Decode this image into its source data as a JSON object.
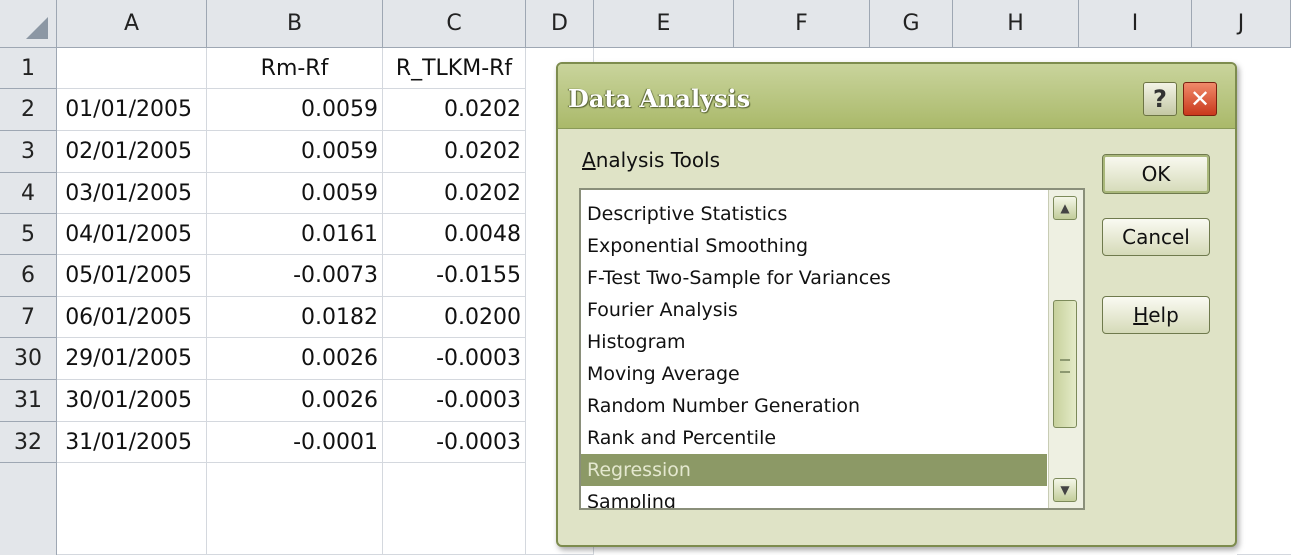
{
  "spreadsheet": {
    "column_headers": [
      "A",
      "B",
      "C",
      "D",
      "E",
      "F",
      "G",
      "H",
      "I",
      "J"
    ],
    "row_headers": [
      "1",
      "2",
      "3",
      "4",
      "5",
      "6",
      "7",
      "30",
      "31",
      "32"
    ],
    "header_row": {
      "A": "",
      "B": "Rm-Rf",
      "C": "R_TLKM-Rf"
    },
    "rows": [
      {
        "date": "01/01/2005",
        "rm_rf": "0.0059",
        "r_tlkm_rf": "0.0202"
      },
      {
        "date": "02/01/2005",
        "rm_rf": "0.0059",
        "r_tlkm_rf": "0.0202"
      },
      {
        "date": "03/01/2005",
        "rm_rf": "0.0059",
        "r_tlkm_rf": "0.0202"
      },
      {
        "date": "04/01/2005",
        "rm_rf": "0.0161",
        "r_tlkm_rf": "0.0048"
      },
      {
        "date": "05/01/2005",
        "rm_rf": "-0.0073",
        "r_tlkm_rf": "-0.0155"
      },
      {
        "date": "06/01/2005",
        "rm_rf": "0.0182",
        "r_tlkm_rf": "0.0200"
      },
      {
        "date": "29/01/2005",
        "rm_rf": "0.0026",
        "r_tlkm_rf": "-0.0003"
      },
      {
        "date": "30/01/2005",
        "rm_rf": "0.0026",
        "r_tlkm_rf": "-0.0003"
      },
      {
        "date": "31/01/2005",
        "rm_rf": "-0.0001",
        "r_tlkm_rf": "-0.0003"
      }
    ]
  },
  "dialog": {
    "title": "Data Analysis",
    "help_glyph": "?",
    "close_glyph": "✕",
    "tools_label_mnemonic": "A",
    "tools_label_rest": "nalysis Tools",
    "tools": [
      "Descriptive Statistics",
      "Exponential Smoothing",
      "F-Test Two-Sample for Variances",
      "Fourier Analysis",
      "Histogram",
      "Moving Average",
      "Random Number Generation",
      "Rank and Percentile",
      "Regression",
      "Sampling"
    ],
    "selected_tool": "Regression",
    "ok_label": "OK",
    "cancel_label": "Cancel",
    "help_mnemonic": "H",
    "help_rest": "elp",
    "scroll_up_icon": "▲",
    "scroll_down_icon": "▼"
  }
}
